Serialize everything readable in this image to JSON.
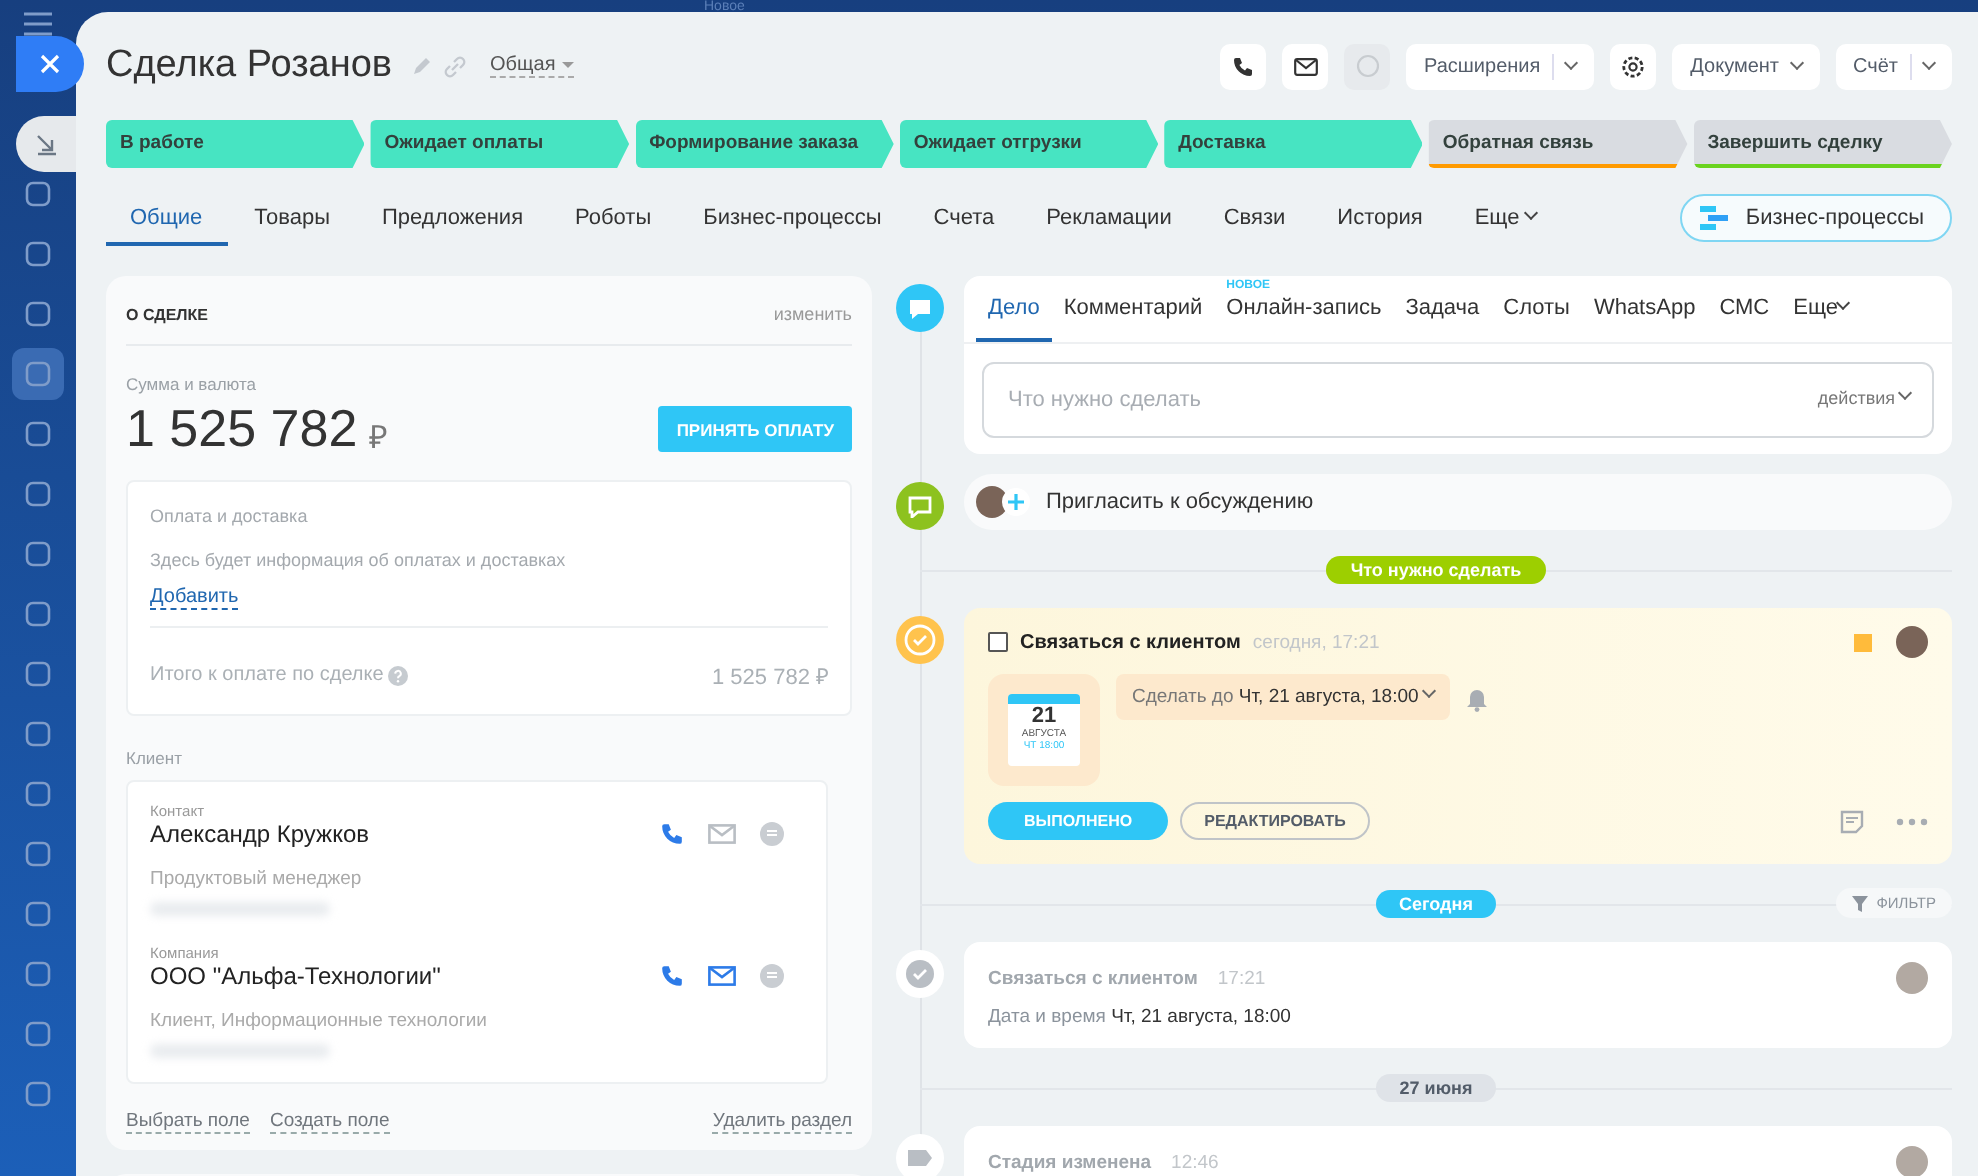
{
  "top_bar": {
    "badge": "Новое"
  },
  "deal": {
    "title": "Сделка Розанов",
    "category": "Общая"
  },
  "toolbar": {
    "extensions": "Расширения",
    "document": "Документ",
    "invoice": "Счёт"
  },
  "stages": [
    {
      "label": "В работе",
      "reached": true,
      "color": "#47e4c2"
    },
    {
      "label": "Ожидает оплаты",
      "reached": true,
      "color": "#47e4c2"
    },
    {
      "label": "Формирование заказа",
      "reached": true,
      "color": "#47e4c2"
    },
    {
      "label": "Ожидает отгрузки",
      "reached": true,
      "color": "#47e4c2"
    },
    {
      "label": "Доставка",
      "reached": true,
      "color": "#47e4c2"
    },
    {
      "label": "Обратная связь",
      "reached": false,
      "color": "#ff9a00"
    },
    {
      "label": "Завершить сделку",
      "reached": false,
      "color": "#6ad31e"
    }
  ],
  "tabs": [
    {
      "label": "Общие",
      "selected": true,
      "kind": "tab"
    },
    {
      "label": "Товары",
      "selected": false,
      "kind": "tab"
    },
    {
      "label": "Предложения",
      "selected": false,
      "kind": "tab"
    },
    {
      "label": "Роботы",
      "selected": false,
      "kind": "tab"
    },
    {
      "label": "Бизнес-процессы",
      "selected": false,
      "kind": "tab"
    },
    {
      "label": "Счета",
      "selected": false,
      "kind": "tab"
    },
    {
      "label": "Рекламации",
      "selected": false,
      "kind": "tab"
    },
    {
      "label": "Связи",
      "selected": false,
      "kind": "tab"
    },
    {
      "label": "История",
      "selected": false,
      "kind": "tab"
    },
    {
      "label": "Еще",
      "selected": false,
      "kind": "menu"
    }
  ],
  "bp_button": "Бизнес-процессы",
  "about": {
    "title": "О СДЕЛКЕ",
    "edit": "изменить",
    "amount_label": "Сумма и валюта",
    "amount": "1 525 782",
    "currency": "₽",
    "pay_button": "ПРИНЯТЬ ОПЛАТУ",
    "payment": {
      "title": "Оплата и доставка",
      "hint": "Здесь будет информация об оплатах и доставках",
      "add": "Добавить",
      "total_label": "Итого к оплате по сделке",
      "total": "1 525 782 ₽"
    },
    "client_label": "Клиент",
    "clients": [
      {
        "label": "Контакт",
        "name": "Александр Кружков",
        "details": "Продуктовый менеджер",
        "email": false
      },
      {
        "label": "Компания",
        "name": "ООО \"Альфа-Технологии\"",
        "details": "Клиент, Информационные технологии",
        "email": true
      }
    ],
    "footer": [
      "Выбрать поле",
      "Создать поле"
    ],
    "delete": "Удалить раздел"
  },
  "timeline": [
    {
      "kind": "composer",
      "tabs": [
        {
          "label": "Дело",
          "selected": true
        },
        {
          "label": "Комментарий",
          "selected": false
        },
        {
          "label": "Онлайн-запись",
          "selected": false,
          "badge": "НОВОЕ"
        },
        {
          "label": "Задача",
          "selected": false
        },
        {
          "label": "Слоты",
          "selected": false
        },
        {
          "label": "WhatsApp",
          "selected": false
        },
        {
          "label": "СМС",
          "selected": false
        },
        {
          "label": "Еще",
          "selected": false,
          "menu": true
        }
      ],
      "placeholder": "Что нужно сделать",
      "actions": "действия"
    },
    {
      "kind": "invite",
      "text": "Пригласить к обсуждению"
    },
    {
      "kind": "divider",
      "text": "Что нужно сделать",
      "color": "#9dcf00"
    },
    {
      "kind": "task",
      "title": "Связаться с клиентом",
      "time": "сегодня, 17:21",
      "checked": false,
      "calendar": {
        "day": "21",
        "month": "АВГУСТА",
        "time": "ЧТ 18:00"
      },
      "deadline_label": "Сделать до",
      "deadline": "Чт, 21 августа, 18:00",
      "done_button": "ВЫПОЛНЕНО",
      "edit_button": "РЕДАКТИРОВАТЬ"
    },
    {
      "kind": "divider",
      "text": "Сегодня",
      "color": "#2fc6f6",
      "filter": "ФИЛЬТР"
    },
    {
      "kind": "activity",
      "title": "Связаться с клиентом",
      "time": "17:21",
      "label": "Дата и время",
      "value": "Чт, 21 августа, 18:00"
    },
    {
      "kind": "divider",
      "text": "27 июня",
      "color": "#dfe3e8"
    },
    {
      "kind": "stage",
      "title": "Стадия изменена",
      "time": "12:46"
    }
  ]
}
